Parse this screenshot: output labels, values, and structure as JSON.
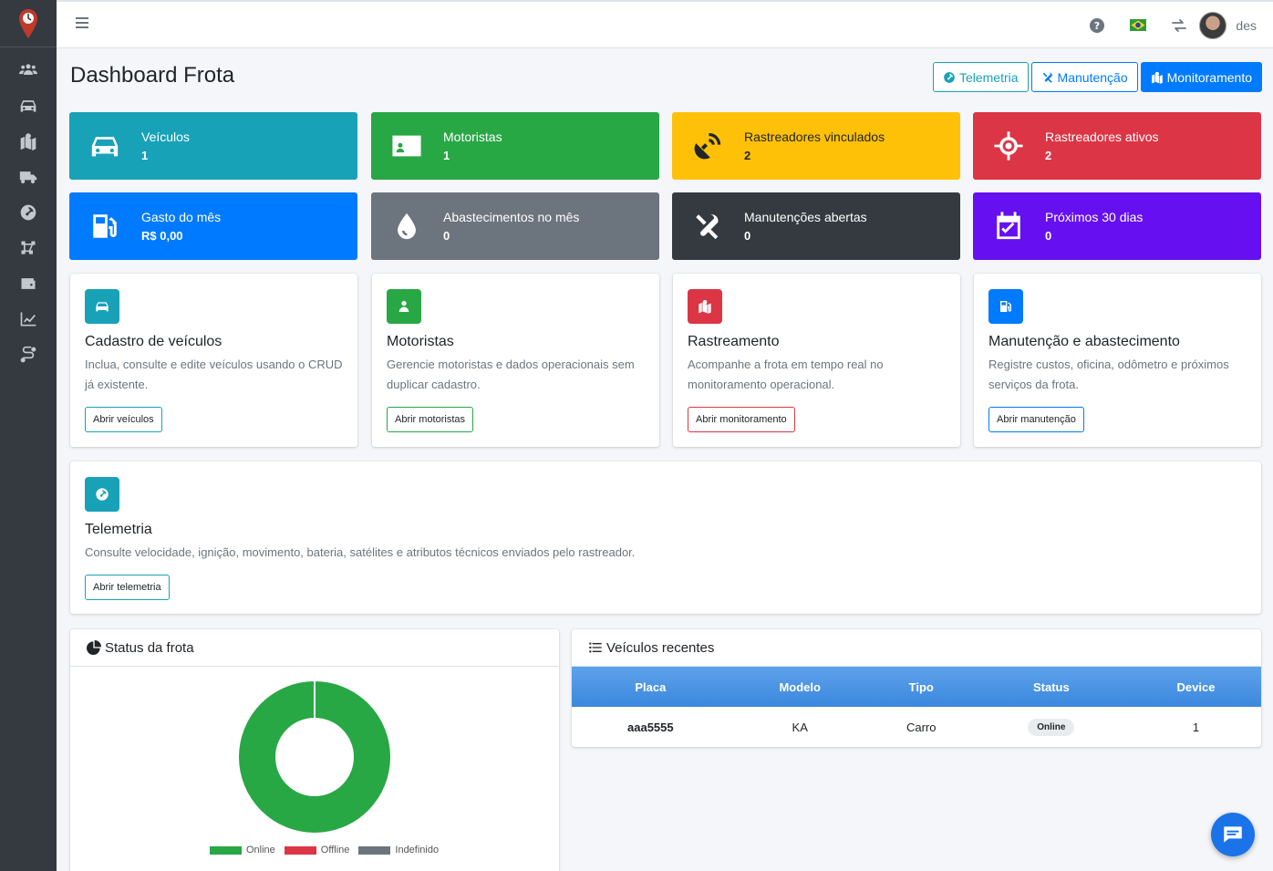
{
  "topbar": {
    "user": "des",
    "icons": [
      "help-icon",
      "brazil-flag-icon",
      "switch-icon"
    ]
  },
  "page": {
    "title": "Dashboard Frota",
    "buttons": {
      "telemetria": "Telemetria",
      "manutencao": "Manutenção",
      "monitoramento": "Monitoramento"
    }
  },
  "stats": [
    {
      "label": "Veículos",
      "value": "1",
      "color": "#17a2b8",
      "icon": "car-icon"
    },
    {
      "label": "Motoristas",
      "value": "1",
      "color": "#28a745",
      "icon": "id-card-icon"
    },
    {
      "label": "Rastreadores vinculados",
      "value": "2",
      "color": "#ffc107",
      "icon": "satellite-dish-icon"
    },
    {
      "label": "Rastreadores ativos",
      "value": "2",
      "color": "#dc3545",
      "icon": "crosshairs-icon"
    },
    {
      "label": "Gasto do mês",
      "value": "R$ 0,00",
      "color": "#007bff",
      "icon": "gas-pump-icon"
    },
    {
      "label": "Abastecimentos no mês",
      "value": "0",
      "color": "#6c757d",
      "icon": "droplet-icon"
    },
    {
      "label": "Manutenções abertas",
      "value": "0",
      "color": "#343a40",
      "icon": "tools-icon"
    },
    {
      "label": "Próximos 30 dias",
      "value": "0",
      "color": "#6610f2",
      "icon": "calendar-check-icon"
    }
  ],
  "features": [
    {
      "title": "Cadastro de veículos",
      "desc": "Inclua, consulte e edite veículos usando o CRUD já existente.",
      "button": "Abrir veículos",
      "color": "#17a2b8"
    },
    {
      "title": "Motoristas",
      "desc": "Gerencie motoristas e dados operacionais sem duplicar cadastro.",
      "button": "Abrir motoristas",
      "color": "#28a745"
    },
    {
      "title": "Rastreamento",
      "desc": "Acompanhe a frota em tempo real no monitoramento operacional.",
      "button": "Abrir monitoramento",
      "color": "#dc3545"
    },
    {
      "title": "Manutenção e abastecimento",
      "desc": "Registre custos, oficina, odômetro e próximos serviços da frota.",
      "button": "Abrir manutenção",
      "color": "#007bff"
    }
  ],
  "telemetry_card": {
    "title": "Telemetria",
    "desc": "Consulte velocidade, ignição, movimento, bateria, satélites e atributos técnicos enviados pelo rastreador.",
    "button": "Abrir telemetria"
  },
  "status_panel": {
    "title": "Status da frota"
  },
  "chart_data": {
    "type": "pie",
    "categories": [
      "Online",
      "Offline",
      "Indefinido"
    ],
    "values": [
      1,
      0,
      0
    ],
    "colors": [
      "#28a745",
      "#dc3545",
      "#6c757d"
    ],
    "legend": "bottom"
  },
  "recent_panel": {
    "title": "Veículos recentes",
    "columns": [
      "Placa",
      "Modelo",
      "Tipo",
      "Status",
      "Device"
    ],
    "rows": [
      {
        "placa": "aaa5555",
        "modelo": "KA",
        "tipo": "Carro",
        "status": "Online",
        "device": "1"
      }
    ]
  }
}
